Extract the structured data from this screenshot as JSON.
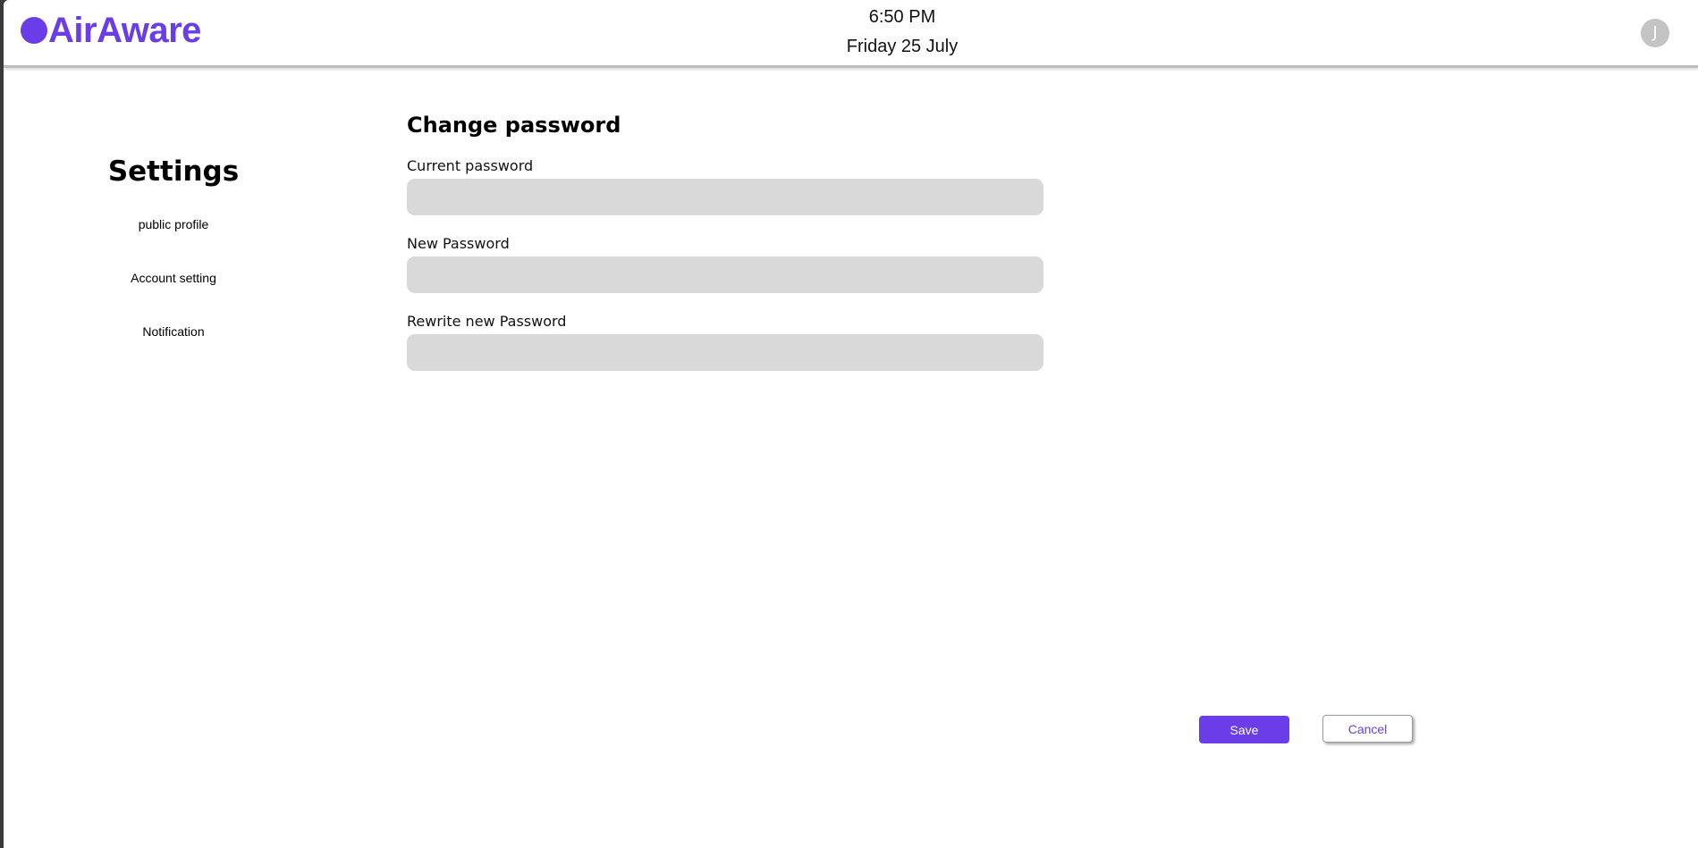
{
  "app": {
    "name": "AirAware",
    "brand_color": "#6a3de8"
  },
  "header": {
    "time": "6:50 PM",
    "date": "Friday 25 July",
    "avatar_initial": "J"
  },
  "sidebar": {
    "title": "Settings",
    "items": [
      {
        "label": "public profile"
      },
      {
        "label": "Account setting"
      },
      {
        "label": "Notification"
      }
    ]
  },
  "form": {
    "title": "Change password",
    "fields": [
      {
        "label": "Current password",
        "value": ""
      },
      {
        "label": "New Password",
        "value": ""
      },
      {
        "label": "Rewrite new Password",
        "value": ""
      }
    ]
  },
  "actions": {
    "save_label": "Save",
    "cancel_label": "Cancel"
  }
}
